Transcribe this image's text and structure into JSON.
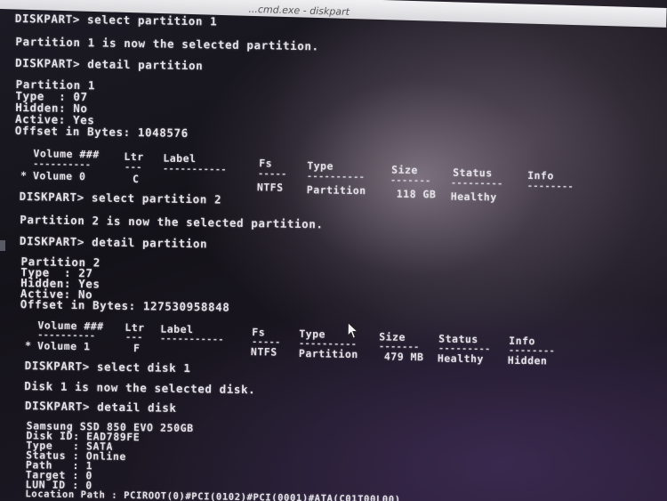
{
  "window": {
    "title": "...cmd.exe - diskpart"
  },
  "lines": {
    "l1": "DISKPART> select partition 1",
    "l2": "Partition 1 is now the selected partition.",
    "l3": "DISKPART> detail partition",
    "l4": "Partition 1",
    "l5": "Type  : 07",
    "l6": "Hidden: No",
    "l7": "Active: Yes",
    "l8": "Offset in Bytes: 1048576",
    "l9": "DISKPART> select partition 2",
    "l10": "Partition 2 is now the selected partition.",
    "l11": "DISKPART> detail partition",
    "l12": "Partition 2",
    "l13": "Type  : 27",
    "l14": "Hidden: Yes",
    "l15": "Active: No",
    "l16": "Offset in Bytes: 127530958848",
    "l17": "DISKPART> select disk 1",
    "l18": "Disk 1 is now the selected disk.",
    "l19": "DISKPART> detail disk",
    "l20": "Samsung SSD 850 EVO 250GB",
    "l21": "Disk ID: EAD789FE",
    "l22": "Type   : SATA",
    "l23": "Status : Online",
    "l24": "Path   : 1",
    "l25": "Target : 0",
    "l26": "LUN ID : 0",
    "l27": "Location Path : PCIROOT(0)#PCI(0102)#PCI(0001)#ATA(C01T00L00)"
  },
  "volume_table_1": {
    "headers": {
      "volume": "Volume ###",
      "ltr": "Ltr",
      "label": "Label",
      "fs": "Fs",
      "type": "Type",
      "size": "Size",
      "status": "Status",
      "info": "Info"
    },
    "row": {
      "marker": "*",
      "volume": "Volume 0",
      "ltr": "C",
      "label": "",
      "fs": "NTFS",
      "type": "Partition",
      "size": "118 GB",
      "status": "Healthy",
      "info": ""
    }
  },
  "volume_table_2": {
    "headers": {
      "volume": "Volume ###",
      "ltr": "Ltr",
      "label": "Label",
      "fs": "Fs",
      "type": "Type",
      "size": "Size",
      "status": "Status",
      "info": "Info"
    },
    "row": {
      "marker": "*",
      "volume": "Volume 1",
      "ltr": "F",
      "label": "",
      "fs": "NTFS",
      "type": "Partition",
      "size": "479 MB",
      "status": "Healthy",
      "info": "Hidden"
    }
  },
  "dashes": {
    "volume": "----------",
    "ltr": "---",
    "label": "-----------",
    "fs": "-----",
    "type": "----------",
    "size": "-------",
    "status": "---------",
    "info": "--------"
  }
}
